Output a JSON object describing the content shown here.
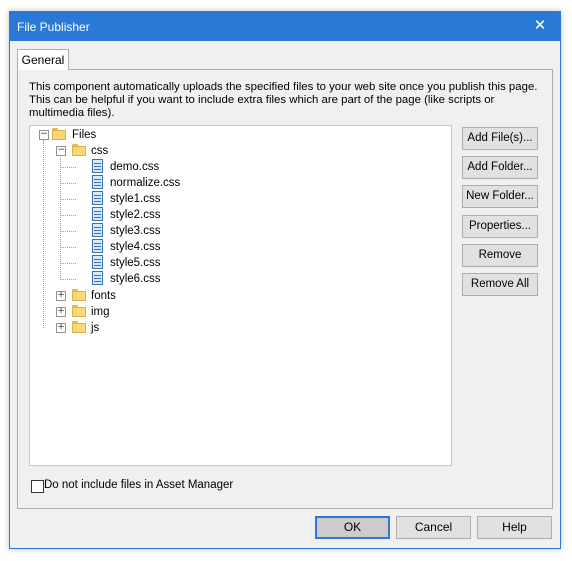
{
  "window": {
    "title": "File Publisher",
    "close_glyph": "✕"
  },
  "tab": {
    "label": "General"
  },
  "description": "This component automatically uploads the specified files to your web site once you publish this page. This can be helpful if you want to include extra files which are part of the page (like scripts or multimedia files).",
  "tree": {
    "root_label": "Files",
    "nodes": [
      {
        "label": "css",
        "icon": "folder-icon",
        "expander": "⊟"
      },
      {
        "label": "demo.css",
        "icon": "css-file-icon"
      },
      {
        "label": "normalize.css",
        "icon": "css-file-icon"
      },
      {
        "label": "style1.css",
        "icon": "css-file-icon"
      },
      {
        "label": "style2.css",
        "icon": "css-file-icon"
      },
      {
        "label": "style3.css",
        "icon": "css-file-icon"
      },
      {
        "label": "style4.css",
        "icon": "css-file-icon"
      },
      {
        "label": "style5.css",
        "icon": "css-file-icon"
      },
      {
        "label": "style6.css",
        "icon": "css-file-icon"
      },
      {
        "label": "fonts",
        "icon": "folder-icon",
        "expander": "⊞"
      },
      {
        "label": "img",
        "icon": "folder-icon",
        "expander": "⊞"
      },
      {
        "label": "js",
        "icon": "folder-icon",
        "expander": "⊞"
      }
    ]
  },
  "side_buttons": {
    "add_files": "Add File(s)...",
    "add_folder": "Add Folder...",
    "new_folder": "New Folder...",
    "properties": "Properties...",
    "remove": "Remove",
    "remove_all": "Remove All"
  },
  "checkbox": {
    "label": "Do not include files in Asset Manager",
    "checked": false
  },
  "footer": {
    "ok": "OK",
    "cancel": "Cancel",
    "help": "Help"
  }
}
